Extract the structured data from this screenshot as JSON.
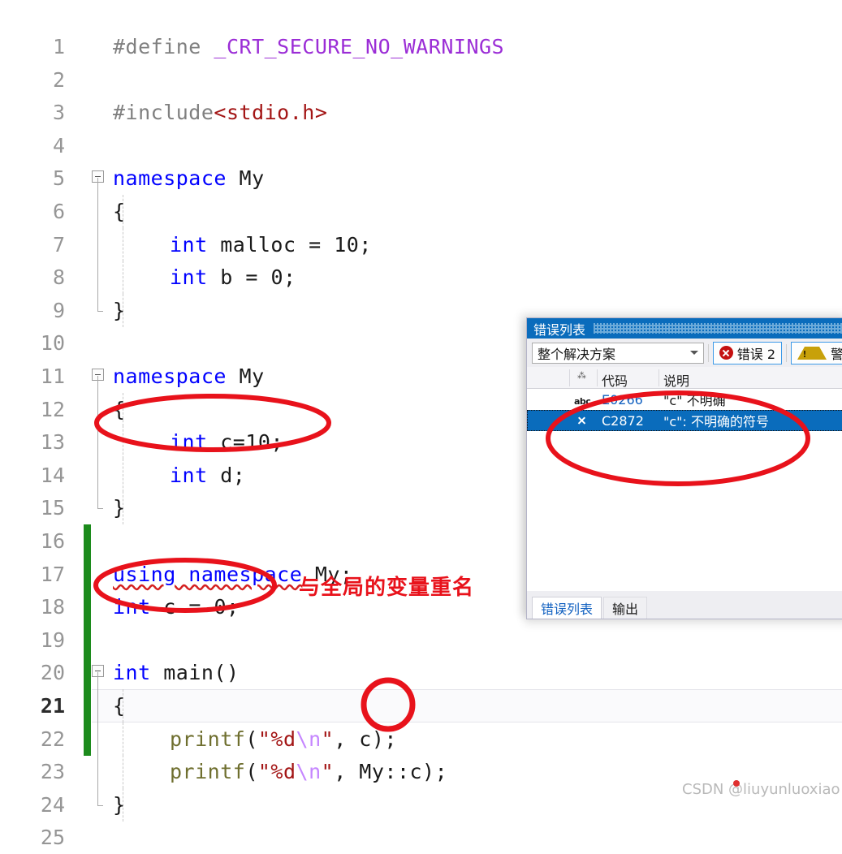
{
  "editor": {
    "lines": [
      {
        "n": "1",
        "indent": 0,
        "tokens": [
          {
            "t": "#define ",
            "c": "t-pre"
          },
          {
            "t": "_CRT_SECURE_NO_WARNINGS",
            "c": "t-macro"
          }
        ]
      },
      {
        "n": "2",
        "indent": 0,
        "tokens": []
      },
      {
        "n": "3",
        "indent": 0,
        "tokens": [
          {
            "t": "#include",
            "c": "t-pre"
          },
          {
            "t": "<stdio.h>",
            "c": "t-str"
          }
        ]
      },
      {
        "n": "4",
        "indent": 0,
        "tokens": []
      },
      {
        "n": "5",
        "indent": 0,
        "tokens": [
          {
            "t": "namespace ",
            "c": "t-kw"
          },
          {
            "t": "My",
            "c": "t-plain"
          }
        ]
      },
      {
        "n": "6",
        "indent": 0,
        "tokens": [
          {
            "t": "{",
            "c": "t-plain"
          }
        ]
      },
      {
        "n": "7",
        "indent": 1,
        "tokens": [
          {
            "t": "int ",
            "c": "t-kw"
          },
          {
            "t": "malloc = ",
            "c": "t-plain"
          },
          {
            "t": "10",
            "c": "t-num"
          },
          {
            "t": ";",
            "c": "t-plain"
          }
        ]
      },
      {
        "n": "8",
        "indent": 1,
        "tokens": [
          {
            "t": "int ",
            "c": "t-kw"
          },
          {
            "t": "b = ",
            "c": "t-plain"
          },
          {
            "t": "0",
            "c": "t-num"
          },
          {
            "t": ";",
            "c": "t-plain"
          }
        ]
      },
      {
        "n": "9",
        "indent": 0,
        "tokens": [
          {
            "t": "}",
            "c": "t-plain"
          }
        ]
      },
      {
        "n": "10",
        "indent": 0,
        "tokens": []
      },
      {
        "n": "11",
        "indent": 0,
        "tokens": [
          {
            "t": "namespace ",
            "c": "t-kw"
          },
          {
            "t": "My",
            "c": "t-plain"
          }
        ]
      },
      {
        "n": "12",
        "indent": 0,
        "tokens": [
          {
            "t": "{",
            "c": "t-plain"
          }
        ]
      },
      {
        "n": "13",
        "indent": 1,
        "tokens": [
          {
            "t": "int ",
            "c": "t-kw"
          },
          {
            "t": "c=",
            "c": "t-plain"
          },
          {
            "t": "10",
            "c": "t-num"
          },
          {
            "t": ";",
            "c": "t-plain"
          }
        ]
      },
      {
        "n": "14",
        "indent": 1,
        "tokens": [
          {
            "t": "int ",
            "c": "t-kw"
          },
          {
            "t": "d;",
            "c": "t-plain"
          }
        ]
      },
      {
        "n": "15",
        "indent": 0,
        "tokens": [
          {
            "t": "}",
            "c": "t-plain"
          }
        ]
      },
      {
        "n": "16",
        "indent": 0,
        "tokens": []
      },
      {
        "n": "17",
        "indent": 0,
        "tokens": [
          {
            "t": "using namespace",
            "c": "t-kw squig"
          },
          {
            "t": " My;",
            "c": "t-plain"
          }
        ]
      },
      {
        "n": "18",
        "indent": 0,
        "tokens": [
          {
            "t": "int ",
            "c": "t-kw"
          },
          {
            "t": "c = ",
            "c": "t-plain"
          },
          {
            "t": "0",
            "c": "t-num"
          },
          {
            "t": ";",
            "c": "t-plain"
          }
        ]
      },
      {
        "n": "19",
        "indent": 0,
        "tokens": []
      },
      {
        "n": "20",
        "indent": 0,
        "tokens": [
          {
            "t": "int ",
            "c": "t-kw"
          },
          {
            "t": "main()",
            "c": "t-plain"
          }
        ]
      },
      {
        "n": "21",
        "indent": 0,
        "tokens": [
          {
            "t": "{",
            "c": "t-plain"
          }
        ]
      },
      {
        "n": "22",
        "indent": 1,
        "tokens": [
          {
            "t": "printf",
            "c": "t-fn"
          },
          {
            "t": "(",
            "c": "t-plain"
          },
          {
            "t": "\"%d",
            "c": "t-str"
          },
          {
            "t": "\\n",
            "c": "t-esc"
          },
          {
            "t": "\"",
            "c": "t-str"
          },
          {
            "t": ", c);",
            "c": "t-plain"
          }
        ]
      },
      {
        "n": "23",
        "indent": 1,
        "tokens": [
          {
            "t": "printf",
            "c": "t-fn"
          },
          {
            "t": "(",
            "c": "t-plain"
          },
          {
            "t": "\"%d",
            "c": "t-str"
          },
          {
            "t": "\\n",
            "c": "t-esc"
          },
          {
            "t": "\"",
            "c": "t-str"
          },
          {
            "t": ", My::c);",
            "c": "t-plain"
          }
        ]
      },
      {
        "n": "24",
        "indent": 0,
        "tokens": [
          {
            "t": "}",
            "c": "t-plain"
          }
        ]
      },
      {
        "n": "25",
        "indent": 0,
        "tokens": []
      }
    ]
  },
  "error_panel": {
    "title": "错误列表",
    "scope_dropdown": {
      "selected": "整个解决方案"
    },
    "filters": [
      {
        "name": "errors",
        "label": "错误 2",
        "icon": "error-circle-icon"
      },
      {
        "name": "warnings",
        "label": "警",
        "icon": "warning-triangle-icon"
      }
    ],
    "columns": [
      "",
      "代码",
      "说明"
    ],
    "rows": [
      {
        "icon": "intellisense-abc-icon",
        "code": "E0266",
        "description": "\"c\" 不明确",
        "selected": false
      },
      {
        "icon": "error-x-icon",
        "code": "C2872",
        "description": "\"c\": 不明确的符号",
        "selected": true
      }
    ],
    "tabs": [
      {
        "label": "错误列表",
        "active": true
      },
      {
        "label": "输出",
        "active": false
      }
    ]
  },
  "annotations": {
    "callout_text": "与全局的变量重名"
  },
  "watermark": {
    "text": "CSDN @liuyunluoxiao"
  },
  "colors": {
    "accent_blue": "#0a6cbc",
    "annotation_red": "#e8121b",
    "keyword_blue": "#0000ff",
    "string_red": "#a31515",
    "macro_purple": "#9b2dd6",
    "change_bar_green": "#1c8b1c"
  }
}
